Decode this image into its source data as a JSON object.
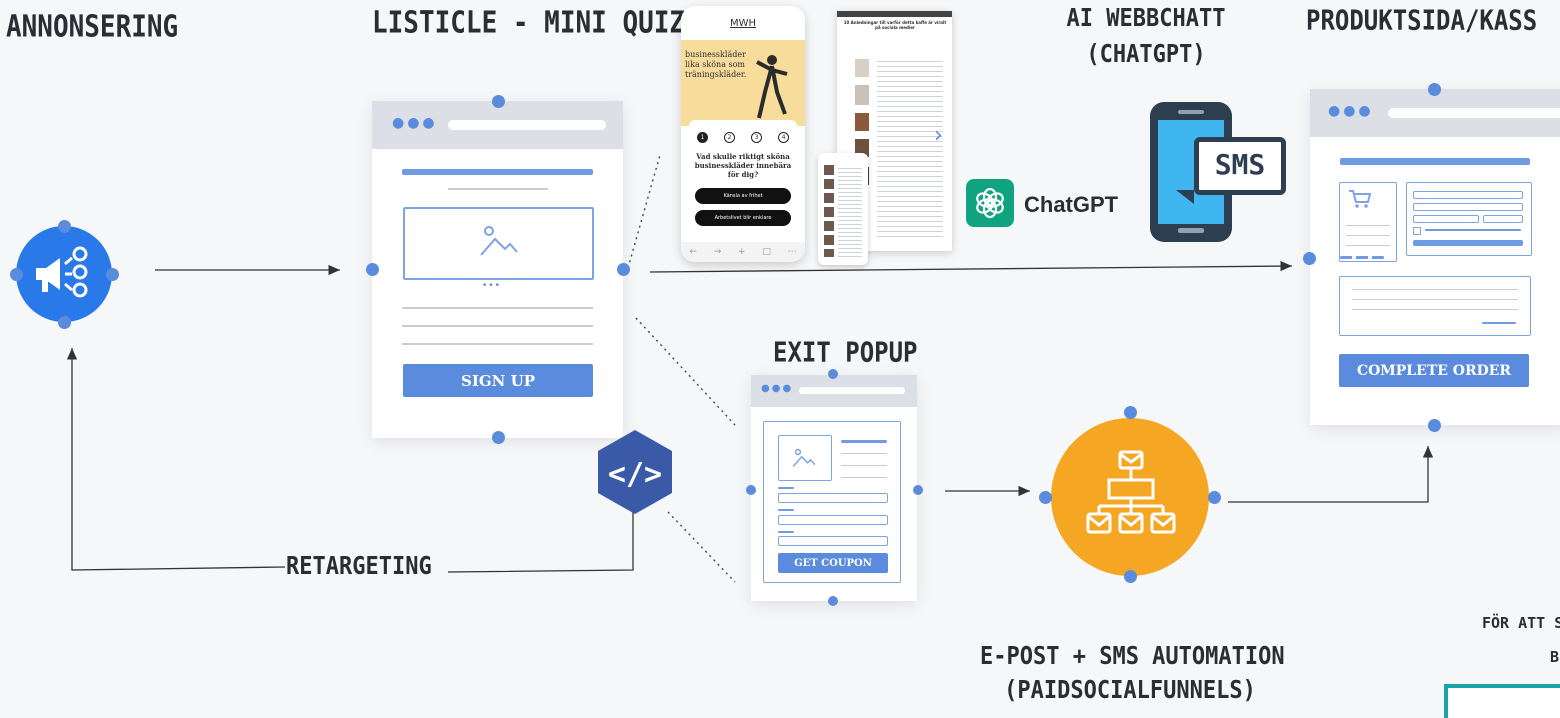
{
  "headings": {
    "ads": "ANNONSERING",
    "listicle": "LISTICLE - MINI QUIZ",
    "ai_chat_line1": "AI WEBBCHATT",
    "ai_chat_line2": "(CHATGPT)",
    "product": "PRODUKTSIDA/KASS",
    "exit_popup": "EXIT POPUP",
    "automation_line1": "E-POST + SMS AUTOMATION",
    "automation_line2": "(PAIDSOCIALFUNNELS)",
    "retargeting": "RETARGETING",
    "footnote_line1": "FÖR ATT S",
    "footnote_line2": "B"
  },
  "listicle_card": {
    "button": "SIGN UP",
    "more": "•••"
  },
  "exit_card": {
    "button": "GET COUPON"
  },
  "product_card": {
    "button": "COMPLETE ORDER"
  },
  "quiz_phone": {
    "brand": "MWH",
    "hero_text": "businesskläder lika sköna som träningskläder.",
    "steps": [
      "1",
      "2",
      "3",
      "4"
    ],
    "question": "Vad skulle riktigt sköna businesskläder innebära för dig?",
    "options": [
      "Känsla av frihet",
      "Arbetslivet blir enklare"
    ]
  },
  "article_screen": {
    "headline": "10 Anledningar till varför detta kaffe är viralt på sociala medier"
  },
  "chatgpt": {
    "label": "ChatGPT"
  },
  "sms": {
    "label": "SMS"
  },
  "colors": {
    "accent": "#5b8bdc",
    "orange": "#f5a623",
    "hex_blue": "#3a5aa8",
    "chatgpt_green": "#10a37f",
    "phone_dark": "#2c3e50",
    "phone_screen": "#3fb6ef"
  }
}
